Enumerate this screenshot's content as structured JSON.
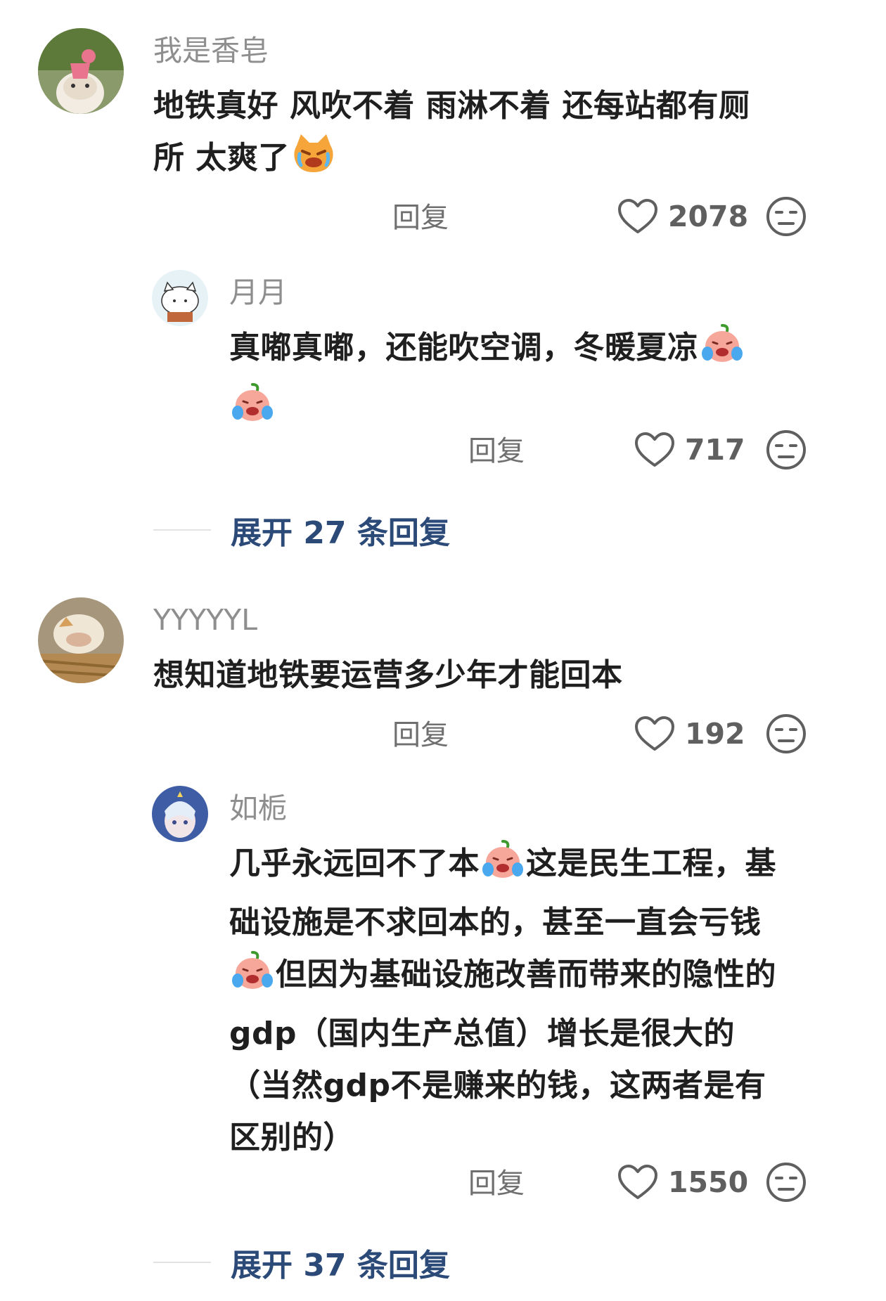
{
  "comments": [
    {
      "username": "我是香皂",
      "text": "地铁真好 风吹不着 雨淋不着 还每站都有厕所 太爽了",
      "text_lines": [
        "地铁真好 风吹不着 雨淋不着 还每站都有厕",
        "所 太爽了"
      ],
      "emoji": "crying-cat-emoji",
      "reply_label": "回复",
      "likes": "2078",
      "replies": [
        {
          "username": "月月",
          "text_lines": [
            "真嘟真嘟，还能吹空调，冬暖夏凉"
          ],
          "emoji": "crying-face-emoji",
          "reply_label": "回复",
          "likes": "717"
        }
      ],
      "expand_label": "展开 27 条回复"
    },
    {
      "username": "YYYYYL",
      "text_lines": [
        "想知道地铁要运营多少年才能回本"
      ],
      "reply_label": "回复",
      "likes": "192",
      "replies": [
        {
          "username": "如栀",
          "text_parts": [
            "几乎永远回不了本",
            "这是民生工程，基",
            "础设施是不求回本的，甚至一直会亏钱",
            "但因为基础设施改善而带来的隐性的",
            "gdp（国内生产总值）增长是很大的",
            "（当然gdp不是赚来的钱，这两者是有",
            "区别的）"
          ],
          "emoji": "crying-face-emoji",
          "reply_label": "回复",
          "likes": "1550"
        }
      ],
      "expand_label": "展开 37 条回复"
    }
  ],
  "colors": {
    "username": "#8e8e8e",
    "text": "#1f1f1f",
    "link": "#2b4a78",
    "icon": "#5f5f5f"
  }
}
